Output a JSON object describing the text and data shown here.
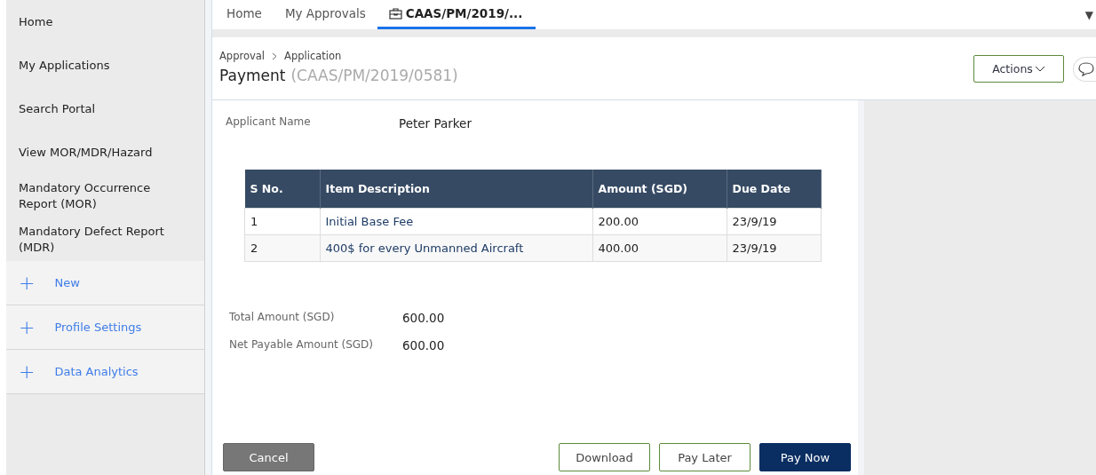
{
  "sidebar": {
    "items": [
      {
        "label": "Home"
      },
      {
        "label": "My Applications"
      },
      {
        "label": "Search Portal"
      },
      {
        "label": "View MOR/MDR/Hazard"
      },
      {
        "label": "Mandatory Occurrence Report (MOR)"
      },
      {
        "label": "Mandatory Defect Report (MDR)"
      }
    ],
    "sections": [
      {
        "icon": "+",
        "label": "New",
        "expanded": false
      },
      {
        "icon": "+",
        "label": "Profile Settings",
        "expanded": false
      },
      {
        "icon": "+",
        "label": "Data Analytics",
        "expanded": false
      }
    ]
  },
  "tabs": [
    {
      "label": "Home",
      "selected": false,
      "kind": "text"
    },
    {
      "label": "My Approvals",
      "selected": false,
      "kind": "text"
    },
    {
      "label": "CAAS/PM/2019/...",
      "selected": true,
      "kind": "case"
    }
  ],
  "tab_menu": "▼",
  "header": {
    "breadcrumb": [
      "Approval",
      "Application"
    ],
    "title": "Payment",
    "case_id": "(CAAS/PM/2019/0581)",
    "actions": "Actions"
  },
  "applicant": {
    "label": "Applicant Name",
    "value": "Peter Parker"
  },
  "table": {
    "columns": [
      "S No.",
      "Item Description",
      "Amount (SGD)",
      "Due Date"
    ],
    "rows": [
      [
        "1",
        "Initial Base Fee",
        "200.00",
        "23/9/19"
      ],
      [
        "2",
        "400$ for every Unmanned Aircraft",
        "400.00",
        "23/9/19"
      ]
    ]
  },
  "totals": [
    {
      "label": "Total Amount (SGD)",
      "value": "600.00"
    },
    {
      "label": "Net Payable Amount (SGD)",
      "value": "600.00"
    }
  ],
  "buttons": [
    {
      "label": "Cancel",
      "kind": "secondary"
    },
    {
      "label": "Download",
      "kind": "outline"
    },
    {
      "label": "Pay Later",
      "kind": "outline"
    },
    {
      "label": "Pay Now",
      "kind": "primary"
    }
  ]
}
